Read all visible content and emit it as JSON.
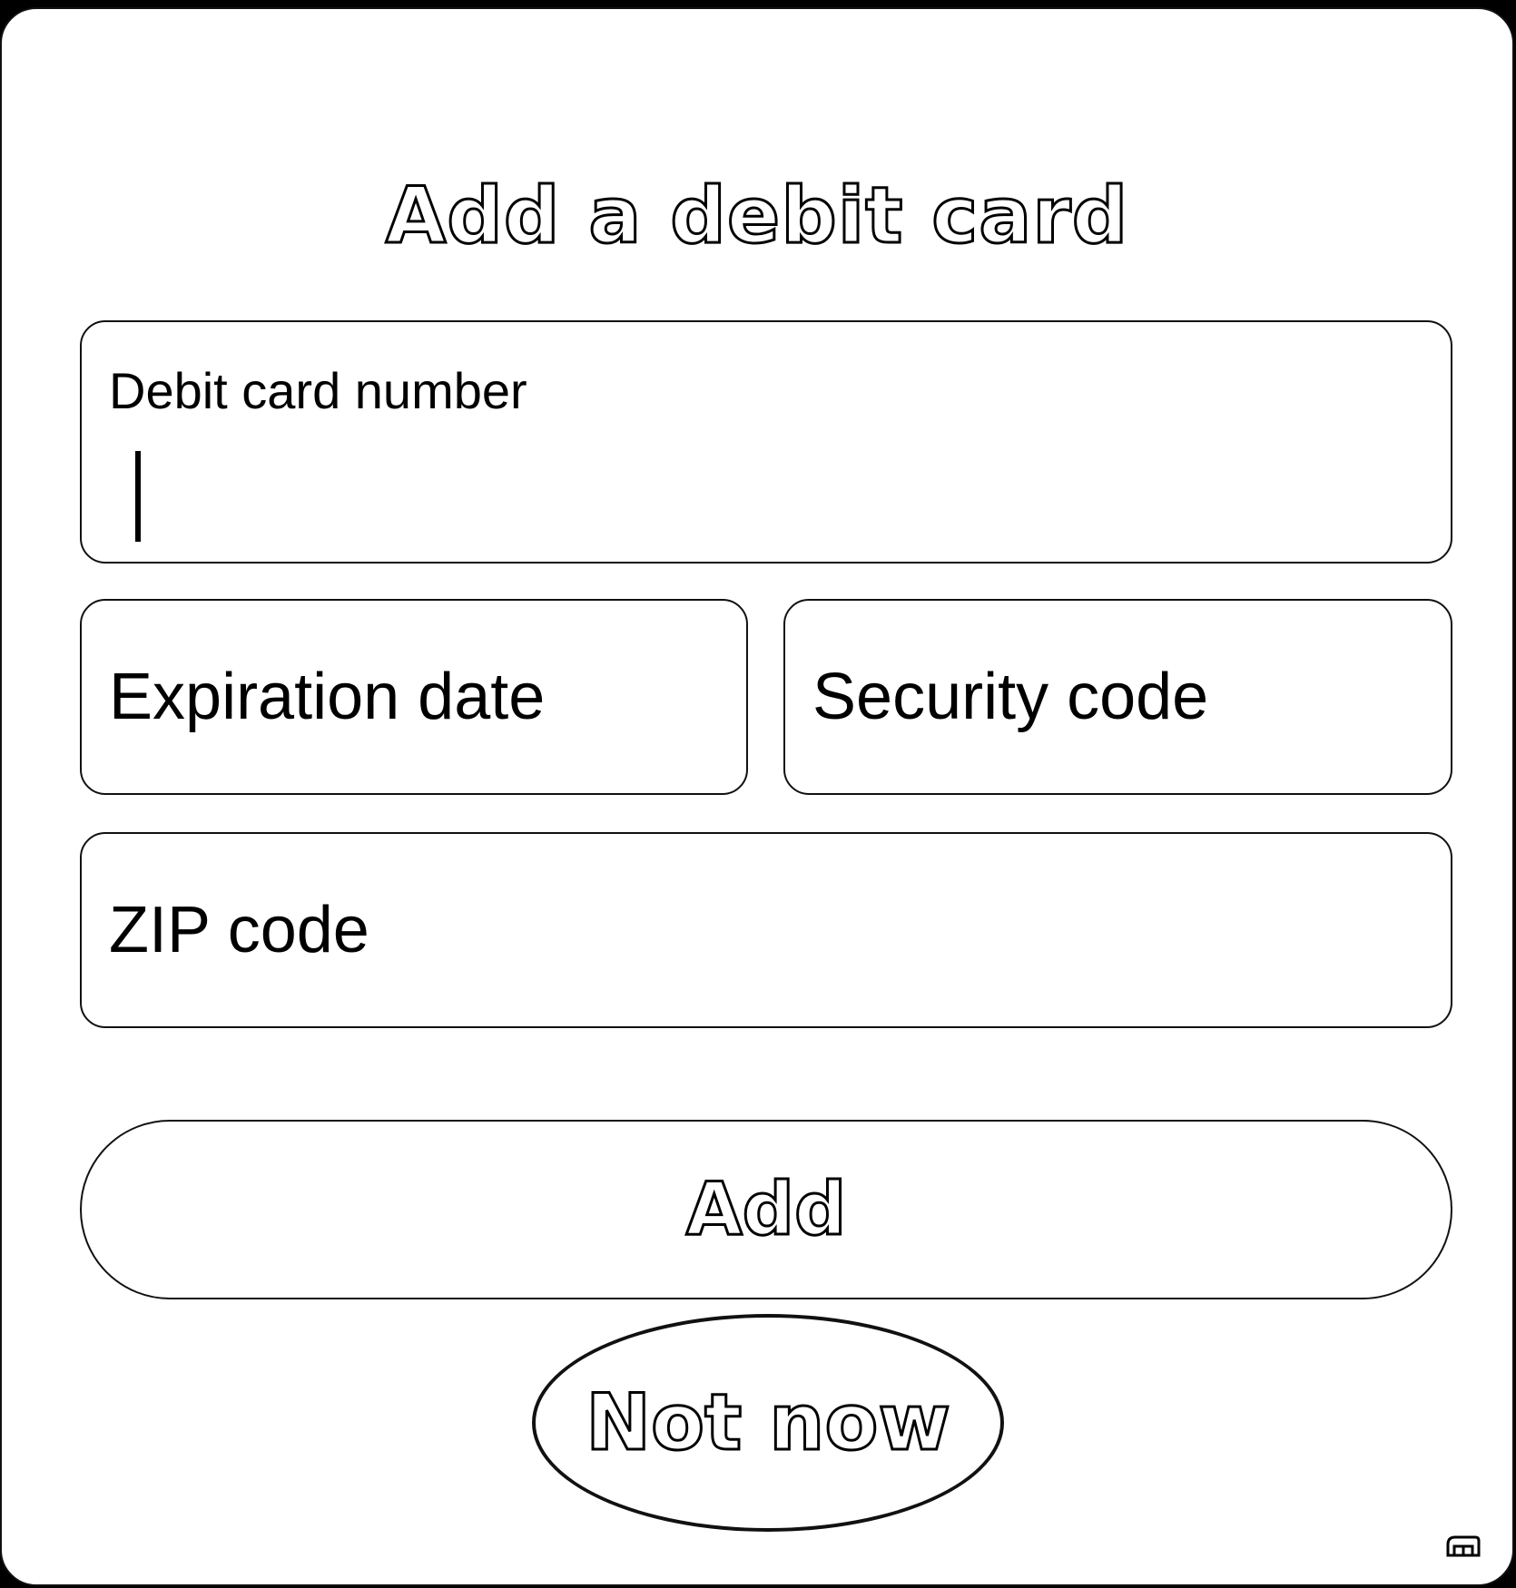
{
  "dialog": {
    "title": "Add a debit card"
  },
  "form": {
    "card_number": {
      "label": "Debit card number",
      "value": ""
    },
    "expiration": {
      "placeholder": "Expiration date"
    },
    "security_code": {
      "placeholder": "Security code"
    },
    "zip": {
      "placeholder": "ZIP code"
    }
  },
  "actions": {
    "add_label": "Add",
    "not_now_label": "Not now"
  },
  "icons": {
    "corner": "wallet-icon"
  }
}
